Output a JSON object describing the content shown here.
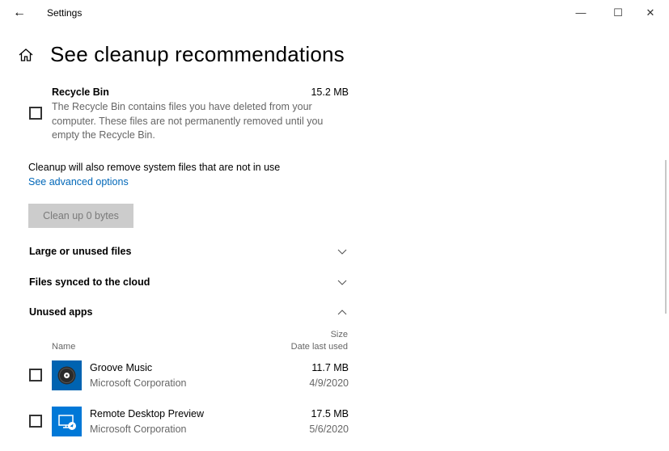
{
  "window": {
    "title": "Settings",
    "back_glyph": "←",
    "minimize_glyph": "—",
    "maximize_glyph": "☐",
    "close_glyph": "✕"
  },
  "page": {
    "title": "See cleanup recommendations"
  },
  "recycle_bin": {
    "title": "Recycle Bin",
    "size": "15.2 MB",
    "description": "The Recycle Bin contains files you have deleted from your computer. These files are not permanently removed until you empty the Recycle Bin."
  },
  "system_note": "Cleanup will also remove system files that are not in use",
  "advanced_link": "See advanced options",
  "cleanup_button": "Clean up 0 bytes",
  "sections": {
    "large_files": "Large or unused files",
    "cloud_files": "Files synced to the cloud",
    "unused_apps": "Unused apps"
  },
  "columns": {
    "name": "Name",
    "size": "Size",
    "date": "Date last used"
  },
  "apps": [
    {
      "name": "Groove Music",
      "publisher": "Microsoft Corporation",
      "size": "11.7 MB",
      "date": "4/9/2020",
      "icon": "groove-music-icon",
      "color": "#0063b1"
    },
    {
      "name": "Remote Desktop Preview",
      "publisher": "Microsoft Corporation",
      "size": "17.5 MB",
      "date": "5/6/2020",
      "icon": "remote-desktop-icon",
      "color": "#0078d7"
    }
  ],
  "colors": {
    "accent": "#0067b8",
    "disabled_button": "#cccccc"
  }
}
